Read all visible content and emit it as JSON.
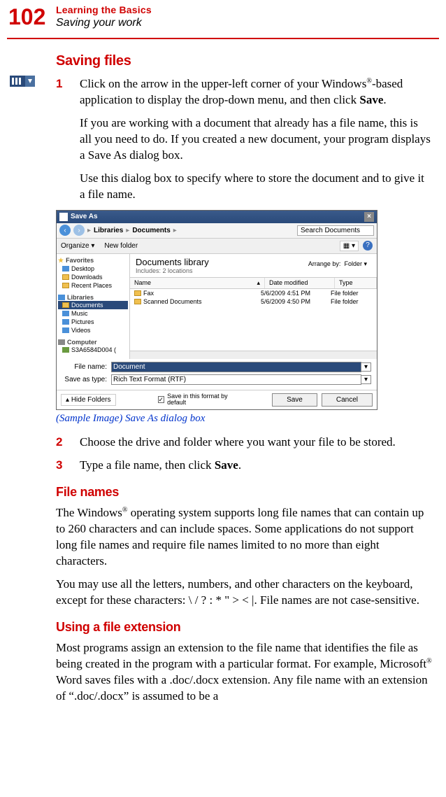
{
  "page_number": "102",
  "chapter_title": "Learning the Basics",
  "chapter_sub": "Saving your work",
  "sections": {
    "saving_files": {
      "heading": "Saving files",
      "step1_num": "1",
      "step1_text_a": "Click on the arrow in the upper-left corner of your Windows",
      "step1_text_b": "-based application to display the drop-down menu, and then click ",
      "step1_text_save": "Save",
      "step1_text_c": ".",
      "step1_p2": "If you are working with a document that already has a file name, this is all you need to do. If you created a new document, your program displays a Save As dialog box.",
      "step1_p3": "Use this dialog box to specify where to store the document and to give it a file name.",
      "caption": "(Sample Image) Save As dialog box",
      "step2_num": "2",
      "step2_text": "Choose the drive and folder where you want your file to be stored.",
      "step3_num": "3",
      "step3_text_a": "Type a file name, then click ",
      "step3_text_save": "Save",
      "step3_text_b": "."
    },
    "file_names": {
      "heading": "File names",
      "p1_a": "The Windows",
      "p1_b": " operating system supports long file names that can contain up to 260 characters and can include spaces. Some applications do not support long file names and require file names limited to no more than eight characters.",
      "p2": "You may use all the letters, numbers, and other characters on the keyboard, except for these characters: \\ / ? : * \" > <  |. File names are not case-sensitive."
    },
    "file_ext": {
      "heading": "Using a file extension",
      "p1_a": "Most programs assign an extension to the file name that identifies the file as being created in the program with a particular format. For example, Microsoft",
      "p1_b": " Word saves files with a .doc/.docx extension. Any file name with an extension of “.doc/.docx” is assumed to be a"
    }
  },
  "dialog": {
    "title": "Save As",
    "nav_back": "‹",
    "nav_fwd": "›",
    "path_seg1": "Libraries",
    "path_seg2": "Documents",
    "search_placeholder": "Search Documents",
    "toolbar": {
      "organize": "Organize",
      "newfolder": "New folder"
    },
    "sidebar": {
      "fav_head": "Favorites",
      "desktop": "Desktop",
      "downloads": "Downloads",
      "recent": "Recent Places",
      "lib_head": "Libraries",
      "documents": "Documents",
      "music": "Music",
      "pictures": "Pictures",
      "videos": "Videos",
      "comp_head": "Computer",
      "drive": "S3A6584D004 ("
    },
    "main": {
      "lib_title": "Documents library",
      "lib_sub": "Includes: 2 locations",
      "arrange_lbl": "Arrange by:",
      "arrange_val": "Folder",
      "col_name": "Name",
      "col_date": "Date modified",
      "col_type": "Type",
      "row1": {
        "name": "Fax",
        "date": "5/6/2009 4:51 PM",
        "type": "File folder"
      },
      "row2": {
        "name": "Scanned Documents",
        "date": "5/6/2009 4:50 PM",
        "type": "File folder"
      }
    },
    "form": {
      "filename_lbl": "File name:",
      "filename_val": "Document",
      "saveas_lbl": "Save as type:",
      "saveas_val": "Rich Text Format (RTF)"
    },
    "footer": {
      "hide": "Hide Folders",
      "chk": "Save in this format by default",
      "save_btn": "Save",
      "cancel_btn": "Cancel"
    }
  }
}
